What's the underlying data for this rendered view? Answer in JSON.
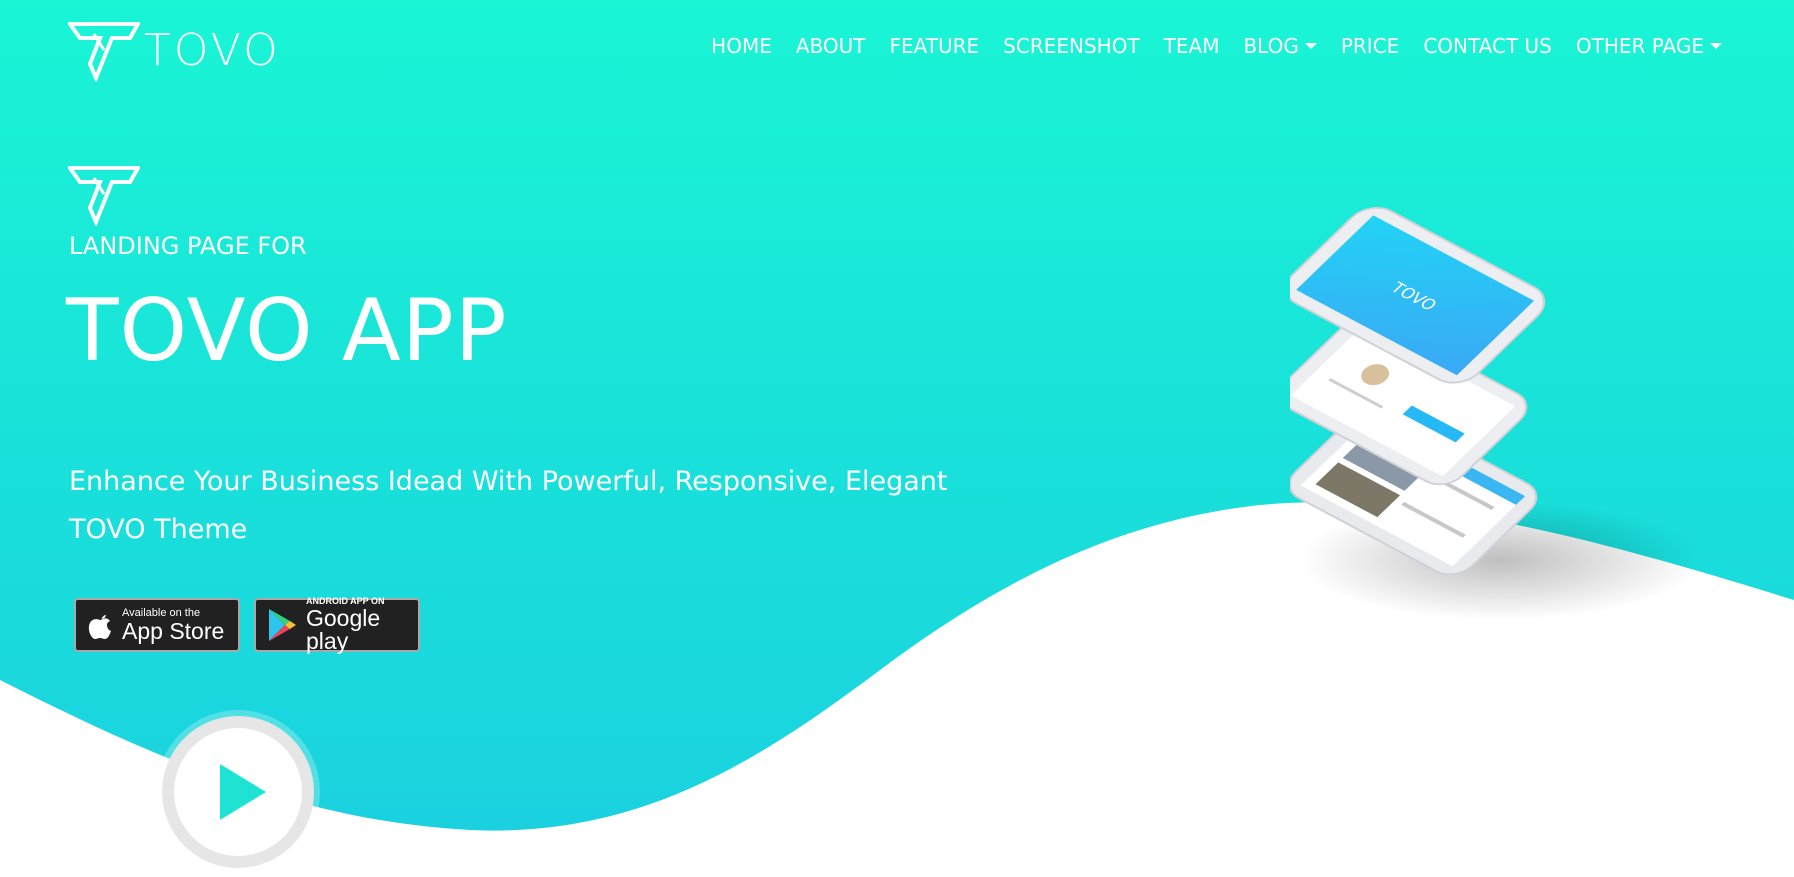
{
  "brand": {
    "name": "TOVO"
  },
  "nav": {
    "items": [
      {
        "label": "HOME"
      },
      {
        "label": "ABOUT"
      },
      {
        "label": "FEATURE"
      },
      {
        "label": "SCREENSHOT"
      },
      {
        "label": "TEAM"
      },
      {
        "label": "BLOG"
      },
      {
        "label": "PRICE"
      },
      {
        "label": "CONTACT US"
      },
      {
        "label": "OTHER PAGE"
      }
    ]
  },
  "hero": {
    "kicker": "LANDING PAGE FOR",
    "title": "TOVO APP",
    "description": "Enhance Your Business Idead With Powerful, Responsive, Elegant TOVO Theme",
    "app_store": {
      "small": "Available on the",
      "big": "App Store"
    },
    "google_play": {
      "small": "ANDROID APP ON",
      "big": "Google play"
    },
    "phone_screen_brand": "TOVO"
  },
  "colors": {
    "gradient_top": "#1af5d6",
    "gradient_bottom": "#1ad0e0",
    "accent": "#1ee3d3"
  },
  "icons": {
    "logo": "tovo-logo-icon",
    "play": "play-icon",
    "apple": "apple-icon",
    "google_play": "google-play-icon"
  }
}
